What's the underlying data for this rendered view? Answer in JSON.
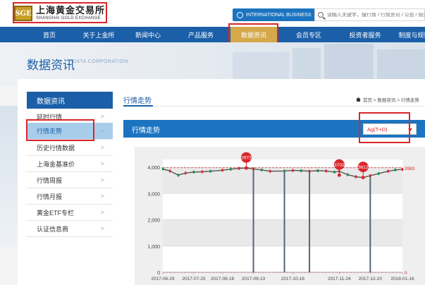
{
  "header": {
    "logo_mark": "SGE",
    "logo_cn": "上海黄金交易所",
    "logo_en": "SHANGHAI GOLD EXCHANGE",
    "intl_button": "INTERNATIONAL BUSINESS",
    "search_placeholder": "请输入关键字，搜行情 / 行情资讯 / 公告 / 规则"
  },
  "nav": {
    "items": [
      {
        "label": "首页"
      },
      {
        "label": "关于上金所"
      },
      {
        "label": "新闻中心"
      },
      {
        "label": "产品服务"
      },
      {
        "label": "数据资讯"
      },
      {
        "label": "会员专区"
      },
      {
        "label": "投资者服务"
      },
      {
        "label": "制度与规则"
      }
    ],
    "active_index": 4
  },
  "banner": {
    "title": "数据资讯",
    "subtitle": "DATA CORPORATION"
  },
  "sidebar": {
    "heading": "数据资讯",
    "items": [
      {
        "label": "延时行情"
      },
      {
        "label": "行情走势"
      },
      {
        "label": "历史行情数据"
      },
      {
        "label": "上海金基准价"
      },
      {
        "label": "行情周报"
      },
      {
        "label": "行情月报"
      },
      {
        "label": "黄金ETF专栏"
      },
      {
        "label": "认证信息商"
      }
    ],
    "active_index": 1
  },
  "main": {
    "title": "行情走势",
    "breadcrumb": "首页 > 数据资讯 > 行情走势",
    "chart_header": "行情走势",
    "select_value": "Ag(T+D)"
  },
  "colors": {
    "brand_blue": "#1a5fa8",
    "accent_gold": "#d5a84a",
    "marker_red": "#d9262b"
  },
  "chart_data": {
    "type": "line",
    "x_ticks": [
      "2017-06-29",
      "2017-07-25",
      "2017-08-18",
      "2017-09-13",
      "2017-10-16",
      "2017-11-24",
      "2017-12-20",
      "2018-01-16"
    ],
    "y_ticks": [
      "0",
      "1,000",
      "2,000",
      "3,000",
      "4,000"
    ],
    "ylim": [
      0,
      4300
    ],
    "x": [
      "2017-06-29",
      "2017-07-05",
      "2017-07-12",
      "2017-07-18",
      "2017-07-25",
      "2017-08-01",
      "2017-08-08",
      "2017-08-18",
      "2017-08-25",
      "2017-09-01",
      "2017-09-07",
      "2017-09-13",
      "2017-09-20",
      "2017-09-27",
      "2017-10-09",
      "2017-10-16",
      "2017-10-23",
      "2017-10-30",
      "2017-11-06",
      "2017-11-13",
      "2017-11-20",
      "2017-11-24",
      "2017-12-01",
      "2017-12-08",
      "2017-12-14",
      "2017-12-20",
      "2017-12-27",
      "2018-01-04",
      "2018-01-10",
      "2018-01-16"
    ],
    "series": [
      {
        "values": [
          3940,
          3860,
          3700,
          3780,
          3820,
          3830,
          3850,
          3890,
          3930,
          3960,
          3972,
          3940,
          3900,
          3850,
          3860,
          3880,
          3870,
          3850,
          3870,
          3860,
          3820,
          3850,
          3720,
          3640,
          3612,
          3680,
          3760,
          3850,
          3900,
          3920
        ]
      }
    ],
    "spikes": [
      {
        "x": "2017-09-13",
        "low": 0
      },
      {
        "x": "2017-10-09",
        "low": 0
      },
      {
        "x": "2017-10-30",
        "low": 0
      },
      {
        "x": "2017-12-20",
        "low": 0
      }
    ],
    "markers": [
      {
        "label": "3972",
        "x": "2017-09-07",
        "value": 3972
      },
      {
        "label": "3702",
        "x": "2017-11-24",
        "value": 3702
      },
      {
        "label": "3612",
        "x": "2017-12-14",
        "value": 3612
      }
    ],
    "right_labels": [
      {
        "label": "3983",
        "value": 3983
      },
      {
        "label": "0",
        "value": 0
      }
    ]
  }
}
